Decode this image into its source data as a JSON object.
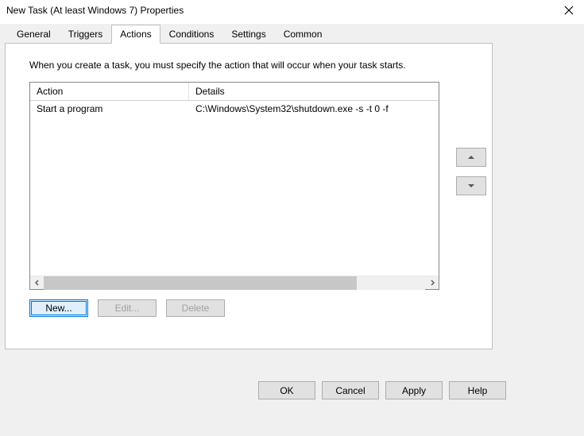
{
  "window": {
    "title": "New Task (At least Windows 7) Properties"
  },
  "tabs": {
    "general": "General",
    "triggers": "Triggers",
    "actions": "Actions",
    "conditions": "Conditions",
    "settings": "Settings",
    "common": "Common"
  },
  "panel": {
    "instruction": "When you create a task, you must specify the action that will occur when your task starts.",
    "columns": {
      "action": "Action",
      "details": "Details"
    },
    "rows": [
      {
        "action": "Start a program",
        "details": "C:\\Windows\\System32\\shutdown.exe -s -t 0 -f"
      }
    ],
    "buttons": {
      "new": "New...",
      "edit": "Edit...",
      "delete": "Delete"
    }
  },
  "dialog_buttons": {
    "ok": "OK",
    "cancel": "Cancel",
    "apply": "Apply",
    "help": "Help"
  }
}
